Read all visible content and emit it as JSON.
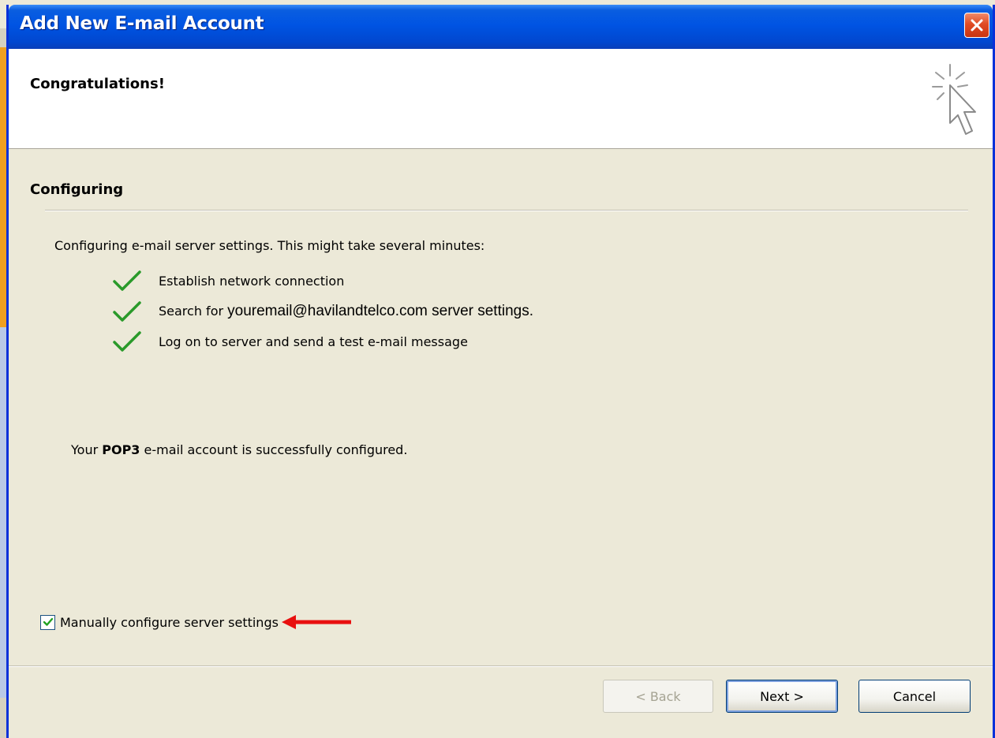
{
  "window": {
    "title": "Add New E-mail Account"
  },
  "header": {
    "title": "Congratulations!"
  },
  "section": {
    "title": "Configuring",
    "intro": "Configuring e-mail server settings. This might take several minutes:"
  },
  "steps": [
    {
      "label": "Establish network connection",
      "status": "done"
    },
    {
      "label_prefix": "Search for ",
      "email": "youremail@havilandtelco.com",
      "label_suffix": " server settings.",
      "status": "done"
    },
    {
      "label": "Log on to server and send a test e-mail message",
      "status": "done"
    }
  ],
  "result": {
    "prefix": "Your ",
    "protocol": "POP3",
    "suffix": " e-mail account is successfully configured."
  },
  "manual_config": {
    "label": "Manually configure server settings",
    "checked": true
  },
  "buttons": {
    "back": "< Back",
    "next": "Next >",
    "cancel": "Cancel"
  },
  "colors": {
    "titlebar": "#0054e3",
    "check_green": "#2a9a2a",
    "annotation_arrow": "#e8100f"
  },
  "icons": {
    "close": "close-icon",
    "wizard": "sparkle-cursor-icon",
    "check": "checkmark-icon",
    "arrow": "red-arrow-left"
  }
}
